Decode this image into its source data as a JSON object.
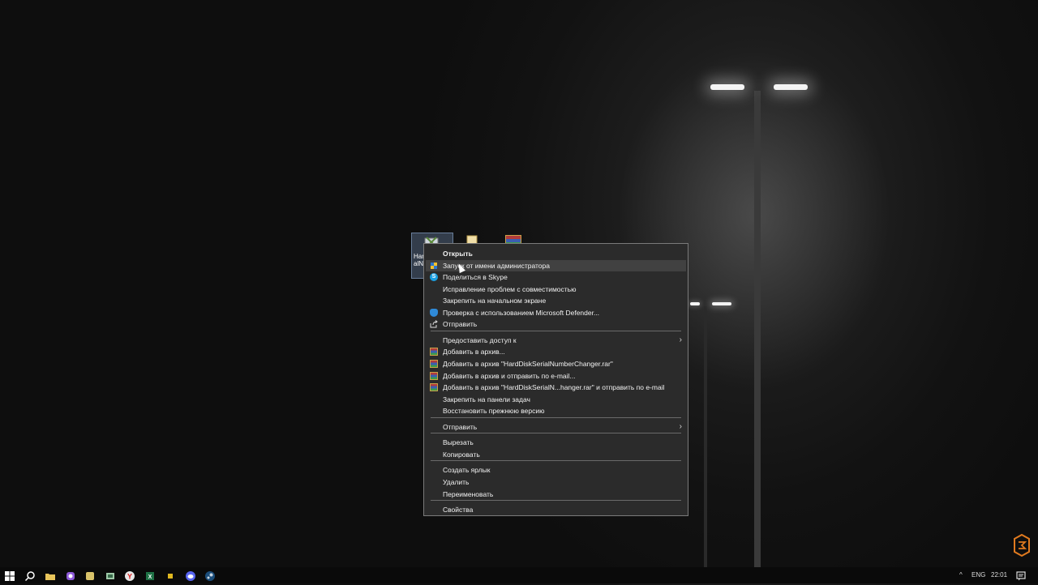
{
  "desktop": {
    "icons": [
      {
        "name": "hdd-changer-shortcut",
        "label_line1": "Hard",
        "label_line2": "alN"
      },
      {
        "name": "folder",
        "label_line1": "",
        "label_line2": ""
      },
      {
        "name": "winrar-archive",
        "label_line1": "",
        "label_line2": ""
      }
    ]
  },
  "context_menu": {
    "items": [
      {
        "label": "Открыть",
        "bold": true,
        "icon": "",
        "submenu": false,
        "hover": false
      },
      {
        "label": "Запуск от имени администратора",
        "icon": "uac-shield-icon",
        "submenu": false,
        "hover": true
      },
      {
        "label": "Поделиться в Skype",
        "icon": "skype-icon",
        "submenu": false
      },
      {
        "label": "Исправление проблем с совместимостью",
        "icon": "",
        "submenu": false
      },
      {
        "label": "Закрепить на начальном экране",
        "icon": "",
        "submenu": false
      },
      {
        "label": "Проверка с использованием Microsoft Defender...",
        "icon": "defender-icon",
        "submenu": false
      },
      {
        "label": "Отправить",
        "icon": "share-icon",
        "submenu": false
      },
      {
        "label": "Предоставить доступ к",
        "icon": "",
        "submenu": true
      },
      {
        "label": "Добавить в архив...",
        "icon": "winrar-icon",
        "submenu": false
      },
      {
        "label": "Добавить в архив \"HardDiskSerialNumberChanger.rar\"",
        "icon": "winrar-icon",
        "submenu": false
      },
      {
        "label": "Добавить в архив и отправить по e-mail...",
        "icon": "winrar-icon",
        "submenu": false
      },
      {
        "label": "Добавить в архив \"HardDiskSerialN...hanger.rar\" и отправить по e-mail",
        "icon": "winrar-icon",
        "submenu": false
      },
      {
        "label": "Закрепить на панели задач",
        "icon": "",
        "submenu": false
      },
      {
        "label": "Восстановить прежнюю версию",
        "icon": "",
        "submenu": false
      },
      {
        "label": "Отправить",
        "icon": "",
        "submenu": true
      },
      {
        "label": "Вырезать",
        "icon": "",
        "submenu": false
      },
      {
        "label": "Копировать",
        "icon": "",
        "submenu": false
      },
      {
        "label": "Создать ярлык",
        "icon": "",
        "submenu": false
      },
      {
        "label": "Удалить",
        "icon": "",
        "submenu": false
      },
      {
        "label": "Переименовать",
        "icon": "",
        "submenu": false
      },
      {
        "label": "Свойства",
        "icon": "",
        "submenu": false
      }
    ],
    "submenu_arrow": "›"
  },
  "taskbar": {
    "icons": [
      "start-icon",
      "search-icon",
      "file-explorer-icon",
      "app-purple-icon",
      "app-yellow-icon",
      "app-green-icon",
      "yandex-browser-icon",
      "excel-icon",
      "app-amber-icon",
      "discord-icon",
      "steam-icon"
    ],
    "tray": {
      "chevron": "^",
      "language": "ENG",
      "time": "22:01",
      "notification_icon": "notification-icon"
    }
  },
  "colors": {
    "menu_bg": "#2b2b2b",
    "menu_hover": "#414141",
    "taskbar_bg": "#0a0a0a"
  }
}
